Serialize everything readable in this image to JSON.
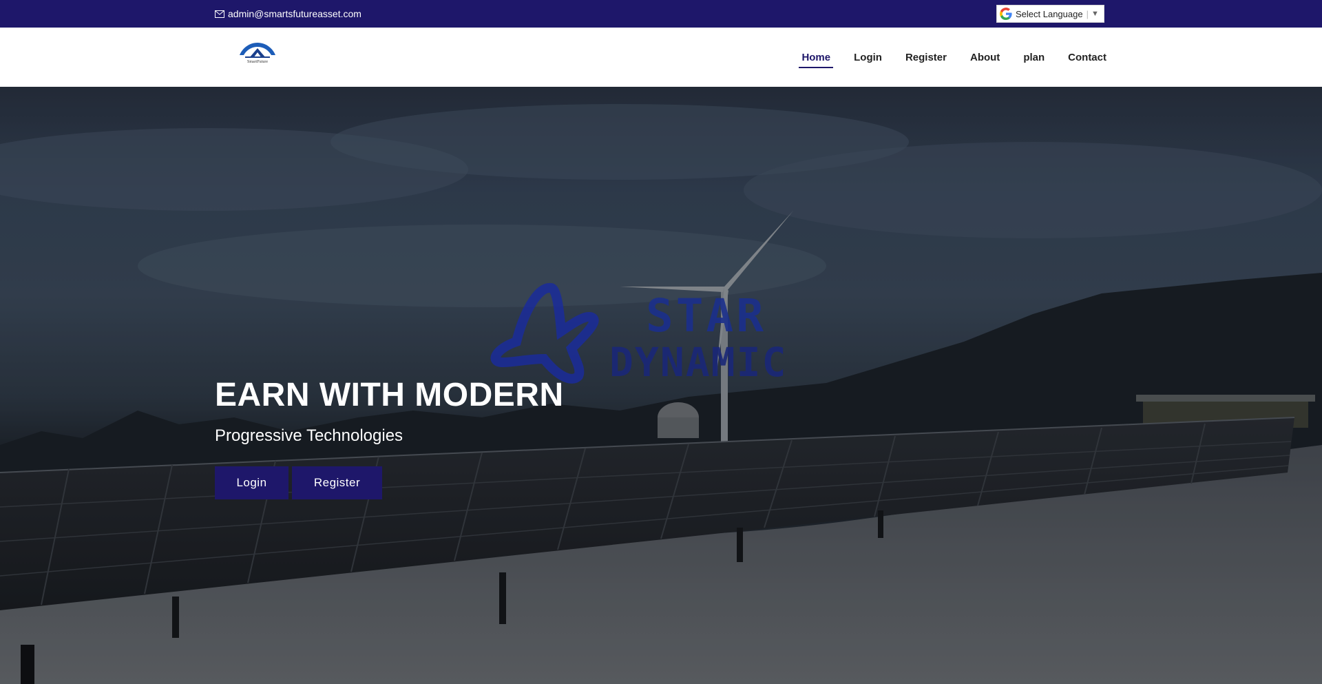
{
  "topbar": {
    "email": "admin@smartsfutureasset.com",
    "email_icon": "envelope-icon",
    "language_label": "Select Language",
    "language_arrow": "▼"
  },
  "header": {
    "logo_alt": "SmartsFuture",
    "nav": [
      {
        "label": "Home",
        "active": true
      },
      {
        "label": "Login"
      },
      {
        "label": "Register"
      },
      {
        "label": "About"
      },
      {
        "label": "plan"
      },
      {
        "label": "Contact"
      }
    ]
  },
  "hero": {
    "watermark_line1": "STAR",
    "watermark_line2": "DYNAMIC",
    "title": "EARN WITH MODERN",
    "subtitle": "Progressive Technologies",
    "login_button": "Login",
    "register_button": "Register"
  },
  "colors": {
    "primary": "#1e176a",
    "white": "#ffffff"
  }
}
